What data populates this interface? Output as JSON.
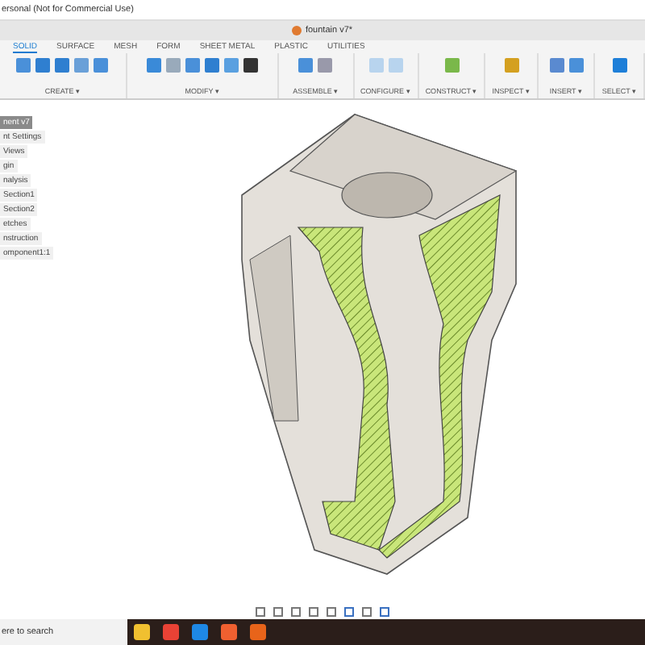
{
  "window": {
    "title": "ersonal (Not for Commercial Use)"
  },
  "document_tab": {
    "title": "fountain v7*"
  },
  "ribbon_tabs": [
    {
      "label": "SOLID",
      "selected": true
    },
    {
      "label": "SURFACE",
      "selected": false
    },
    {
      "label": "MESH",
      "selected": false
    },
    {
      "label": "FORM",
      "selected": false
    },
    {
      "label": "SHEET METAL",
      "selected": false
    },
    {
      "label": "PLASTIC",
      "selected": false
    },
    {
      "label": "UTILITIES",
      "selected": false
    }
  ],
  "toolbar_groups": [
    {
      "label": "CREATE ▾"
    },
    {
      "label": "MODIFY ▾"
    },
    {
      "label": "ASSEMBLE ▾"
    },
    {
      "label": "CONFIGURE ▾"
    },
    {
      "label": "CONSTRUCT ▾"
    },
    {
      "label": "INSPECT ▾"
    },
    {
      "label": "INSERT ▾"
    },
    {
      "label": "SELECT ▾"
    }
  ],
  "browser": {
    "items": [
      {
        "label": "nent v7",
        "selected": true
      },
      {
        "label": "nt Settings",
        "selected": false
      },
      {
        "label": "Views",
        "selected": false
      },
      {
        "label": "gin",
        "selected": false
      },
      {
        "label": "nalysis",
        "selected": false
      },
      {
        "label": "Section1",
        "selected": false
      },
      {
        "label": "Section2",
        "selected": false
      },
      {
        "label": "etches",
        "selected": false
      },
      {
        "label": "nstruction",
        "selected": false
      },
      {
        "label": "omponent1:1",
        "selected": false
      }
    ]
  },
  "taskbar": {
    "search_placeholder": "ere to search"
  }
}
